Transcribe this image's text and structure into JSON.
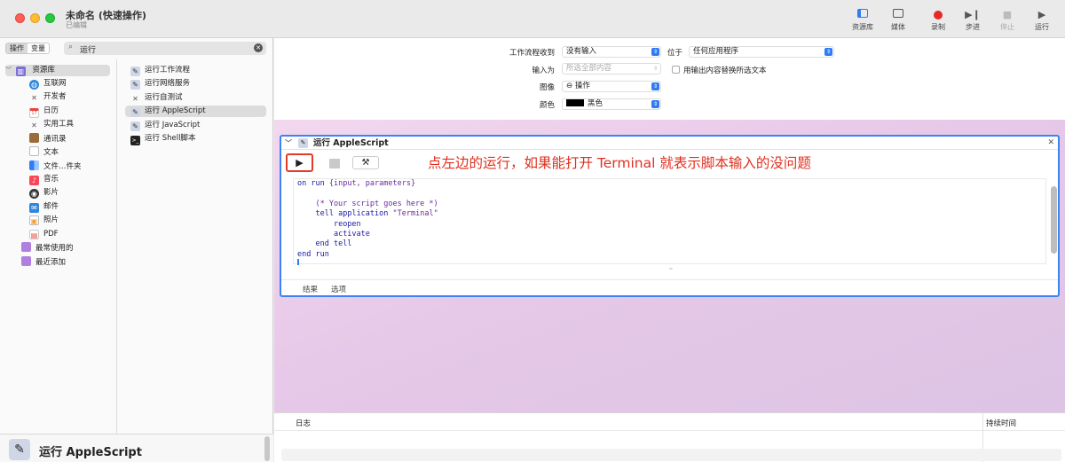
{
  "window": {
    "title": "未命名 (快速操作)",
    "subtitle": "已编辑"
  },
  "toolbar": [
    {
      "label": "资源库",
      "icon": "library-icon",
      "enabled": true
    },
    {
      "label": "媒体",
      "icon": "media-icon",
      "enabled": true
    },
    {
      "label": "录制",
      "icon": "record-icon",
      "enabled": true
    },
    {
      "label": "步进",
      "icon": "step-icon",
      "enabled": true
    },
    {
      "label": "停止",
      "icon": "stop-icon",
      "enabled": false
    },
    {
      "label": "运行",
      "icon": "run-icon",
      "enabled": true
    }
  ],
  "sidebar": {
    "tabs": [
      "操作",
      "变量"
    ],
    "search": {
      "value": "运行"
    },
    "library": [
      {
        "label": "资源库",
        "icon": "library-folder-icon",
        "color": "#7b6fd6"
      },
      {
        "label": "互联网",
        "icon": "globe-icon",
        "color": "#2e86de"
      },
      {
        "label": "开发者",
        "icon": "tools-icon",
        "color": "#555555"
      },
      {
        "label": "日历",
        "icon": "calendar-icon",
        "color": "#e8463a"
      },
      {
        "label": "实用工具",
        "icon": "wrench-icon",
        "color": "#555555"
      },
      {
        "label": "通讯录",
        "icon": "contacts-icon",
        "color": "#9c6b3c"
      },
      {
        "label": "文本",
        "icon": "text-icon",
        "color": "#888888"
      },
      {
        "label": "文件…件夹",
        "icon": "finder-icon",
        "color": "#2f7cf6"
      },
      {
        "label": "音乐",
        "icon": "music-icon",
        "color": "#fa4656"
      },
      {
        "label": "影片",
        "icon": "movie-icon",
        "color": "#333333"
      },
      {
        "label": "邮件",
        "icon": "mail-icon",
        "color": "#2e86de"
      },
      {
        "label": "照片",
        "icon": "photos-icon",
        "color": "#f0a030"
      },
      {
        "label": "PDF",
        "icon": "pdf-icon",
        "color": "#e8463a"
      },
      {
        "label": "最常使用的",
        "icon": "smart-folder-icon",
        "color": "#b07fe0"
      },
      {
        "label": "最近添加",
        "icon": "smart-folder-icon",
        "color": "#b07fe0"
      }
    ],
    "actions": [
      {
        "label": "运行工作流程"
      },
      {
        "label": "运行网络服务"
      },
      {
        "label": "运行自测试"
      },
      {
        "label": "运行 AppleScript"
      },
      {
        "label": "运行 JavaScript"
      },
      {
        "label": "运行 Shell脚本"
      }
    ],
    "detail": {
      "title": "运行 AppleScript"
    }
  },
  "settings": {
    "receives_label": "工作流程收到",
    "receives_value": "没有输入",
    "in_label": "位于",
    "in_value": "任何应用程序",
    "input_label": "输入为",
    "input_value": "所选全部内容",
    "replace_label": "用输出内容替换所选文本",
    "image_label": "图像",
    "image_value": "⊖ 操作",
    "color_label": "颜色",
    "color_value": "黑色"
  },
  "action_card": {
    "title": "运行 AppleScript",
    "annotation": "点左边的运行，如果能打开 Terminal 就表示脚本输入的没问题",
    "code": [
      "on run {input, parameters}",
      "",
      "    (* Your script goes here *)",
      "    tell application \"Terminal\"",
      "        reopen",
      "        activate",
      "    end tell",
      "end run"
    ],
    "tabs": [
      "结果",
      "选项"
    ]
  },
  "log": {
    "col_log": "日志",
    "col_duration": "持续时间"
  }
}
